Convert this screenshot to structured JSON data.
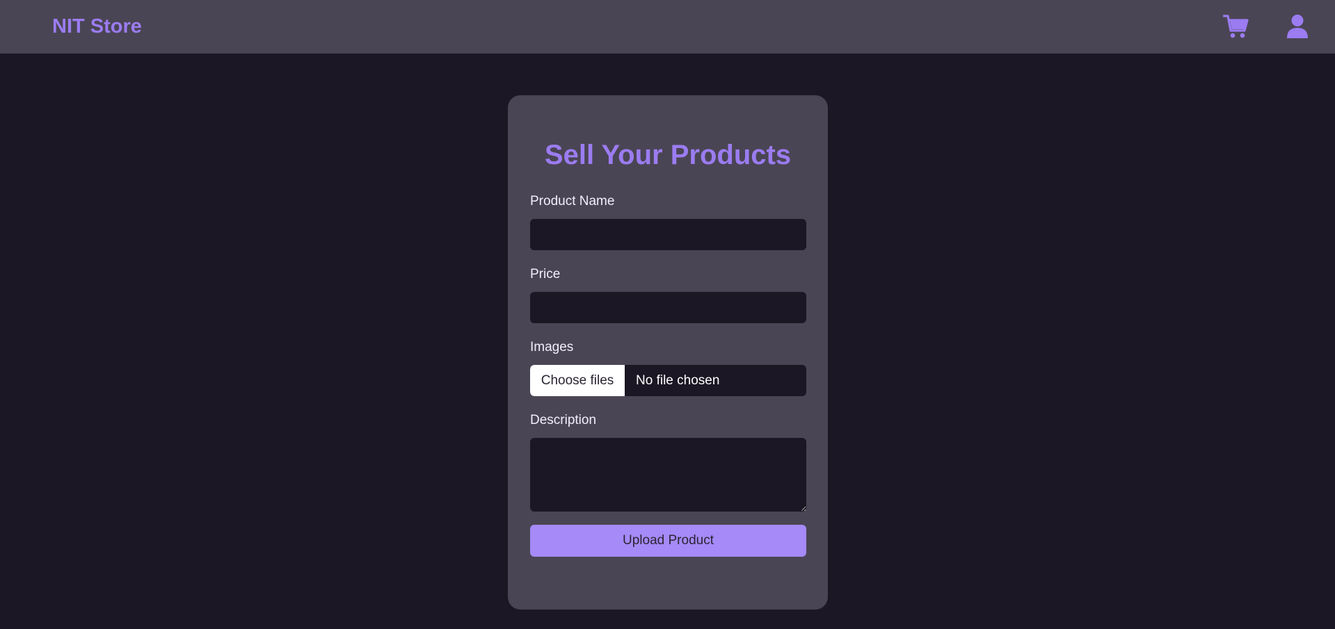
{
  "navbar": {
    "brand": "NIT Store",
    "cart_icon": "cart-icon",
    "user_icon": "user-icon",
    "accent": "#9b7cf1"
  },
  "form": {
    "title": "Sell Your Products",
    "product_name_label": "Product Name",
    "product_name_value": "",
    "price_label": "Price",
    "price_value": "",
    "images_label": "Images",
    "choose_files_label": "Choose files",
    "file_status": "No file chosen",
    "description_label": "Description",
    "description_value": "",
    "submit_label": "Upload Product"
  },
  "colors": {
    "background": "#1b1724",
    "surface": "#4a4554",
    "accent": "#9b7cf1",
    "button": "#a58af8"
  }
}
